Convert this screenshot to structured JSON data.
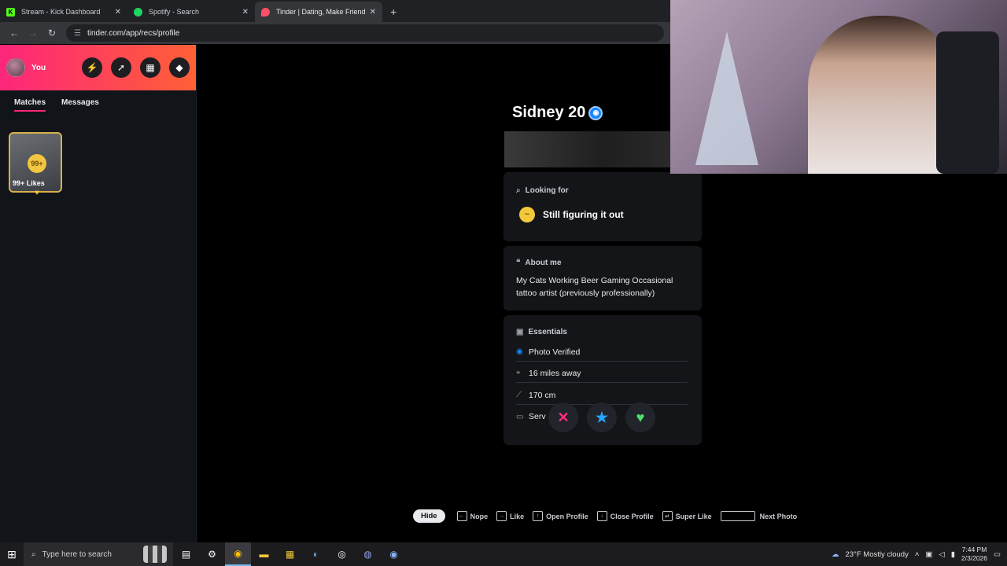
{
  "browser": {
    "tabs": [
      {
        "title": "Stream - Kick Dashboard",
        "favicon": "kick-icon",
        "color": "#53fc18",
        "glyph": "K"
      },
      {
        "title": "Spotify - Search",
        "favicon": "spotify-icon",
        "color": "#1ed760",
        "glyph": ""
      },
      {
        "title": "Tinder | Dating, Make Friends &",
        "favicon": "tinder-icon",
        "color": "#fd5068",
        "glyph": ""
      }
    ],
    "new_tab": "+",
    "url": "tinder.com/app/recs/profile"
  },
  "sidebar": {
    "user_label": "You",
    "icons": [
      "boost-icon",
      "explore-icon",
      "gift-icon",
      "shield-icon"
    ],
    "tabs": [
      "Matches",
      "Messages"
    ],
    "likes_badge": "99+",
    "likes_label": "99+ Likes"
  },
  "profile": {
    "name_age": "Sidney 20",
    "looking_for": {
      "title": "Looking for",
      "value": "Still figuring it out"
    },
    "about": {
      "title": "About me",
      "text": "My Cats Working Beer Gaming Occasional tattoo artist (previously professionally)"
    },
    "essentials": {
      "title": "Essentials",
      "rows": [
        {
          "icon": "verified-icon",
          "text": "Photo Verified"
        },
        {
          "icon": "location-icon",
          "text": "16 miles away"
        },
        {
          "icon": "ruler-icon",
          "text": "170 cm"
        },
        {
          "icon": "briefcase-icon",
          "text": "Serv"
        }
      ]
    },
    "actions": [
      {
        "name": "nope-button",
        "glyph": "✕",
        "color": "#ff2e77"
      },
      {
        "name": "super-like-button",
        "glyph": "★",
        "color": "#26a6ff"
      },
      {
        "name": "like-button",
        "glyph": "♥",
        "color": "#4be06b"
      }
    ]
  },
  "hints": {
    "hide": "Hide",
    "items": [
      "Nope",
      "Like",
      "Open Profile",
      "Close Profile",
      "Super Like",
      "Next Photo"
    ]
  },
  "taskbar": {
    "search_placeholder": "Type here to search",
    "weather": "23°F  Mostly cloudy",
    "time": "7:44 PM",
    "date": "2/3/2026"
  }
}
